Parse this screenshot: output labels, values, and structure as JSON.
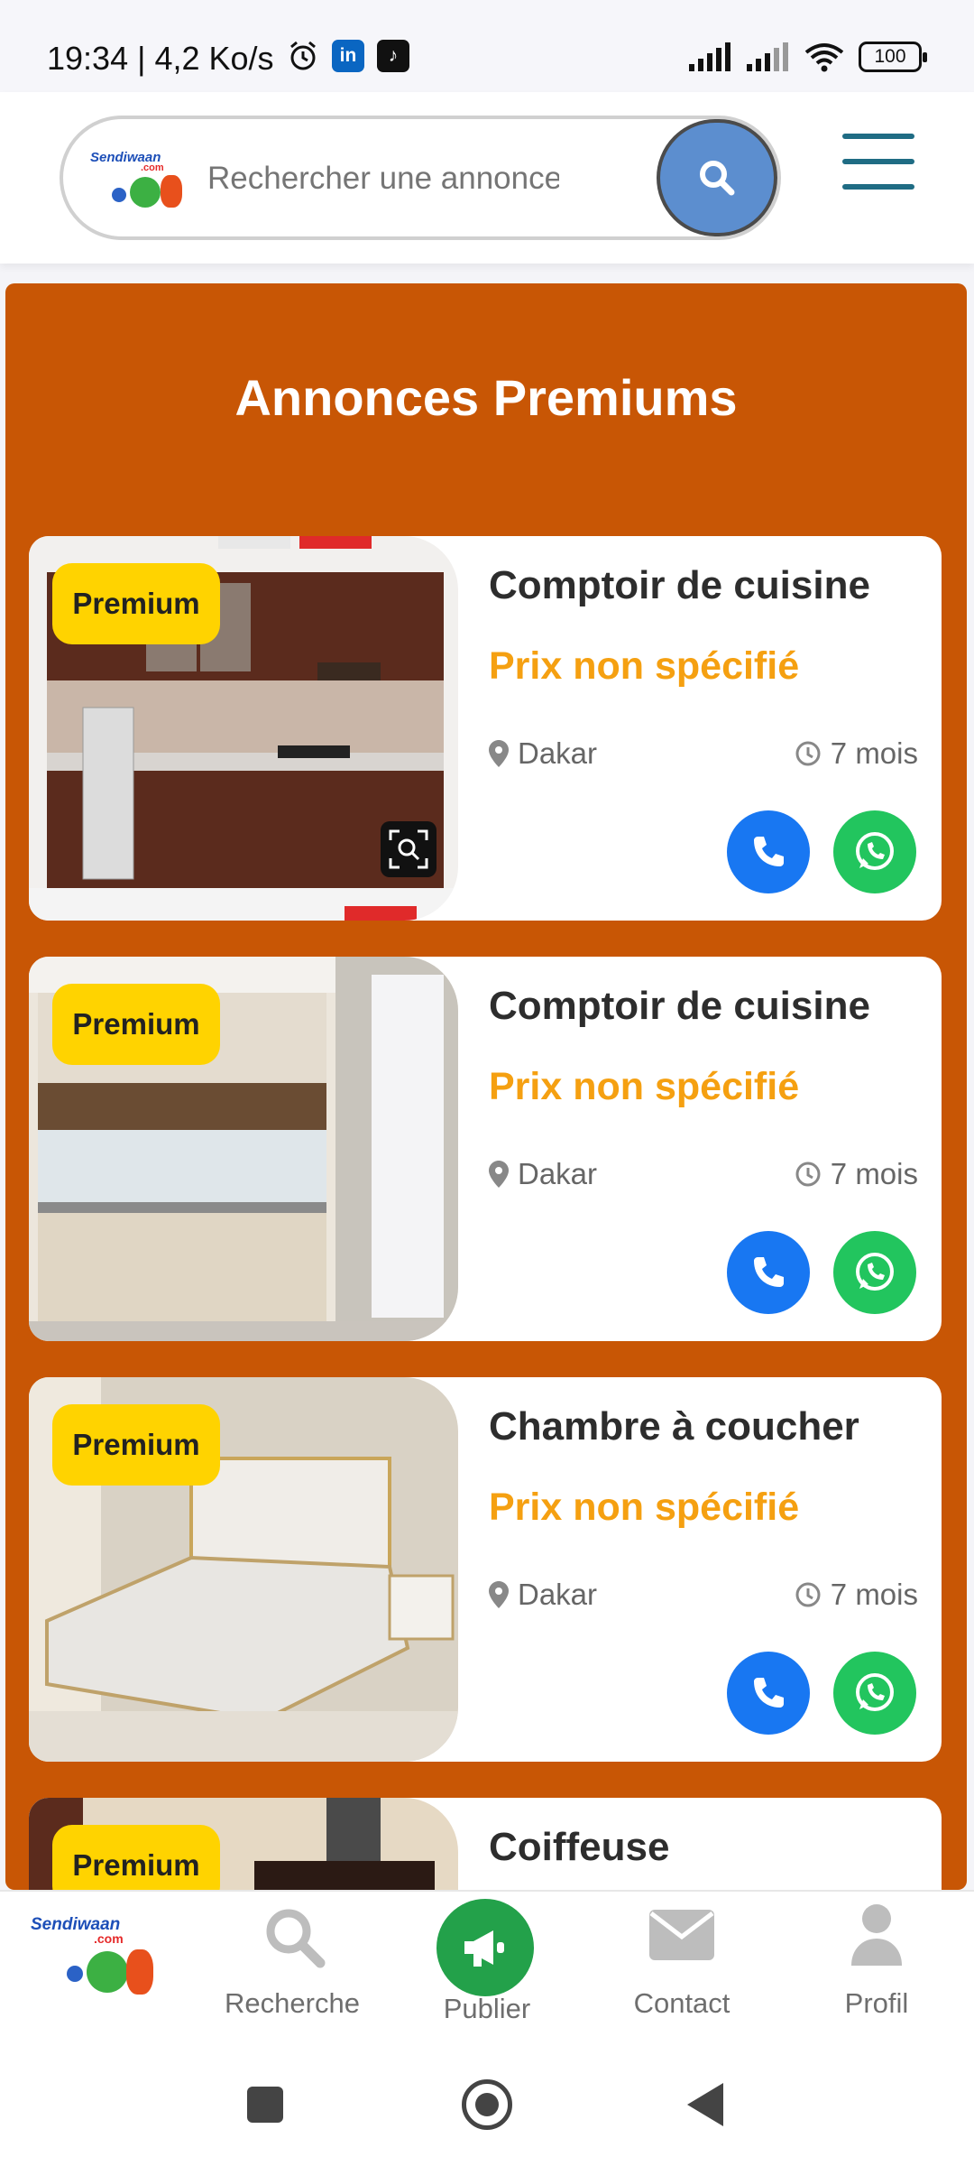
{
  "status_bar": {
    "time": "19:34 | 4,2 Ko/s",
    "battery": "100"
  },
  "header": {
    "logo_text": "Sendiwaan",
    "logo_subtext": ".com",
    "search": {
      "placeholder": "Rechercher une annonce",
      "value": ""
    }
  },
  "section": {
    "title": "Annonces Premiums"
  },
  "listings": [
    {
      "badge": "Premium",
      "title": "Comptoir de cuisine",
      "price": "Prix non spécifié",
      "location": "Dakar",
      "age": "7 mois"
    },
    {
      "badge": "Premium",
      "title": "Comptoir de cuisine",
      "price": "Prix non spécifié",
      "location": "Dakar",
      "age": "7 mois"
    },
    {
      "badge": "Premium",
      "title": "Chambre à coucher",
      "price": "Prix non spécifié",
      "location": "Dakar",
      "age": "7 mois"
    },
    {
      "badge": "Premium",
      "title": "Coiffeuse"
    }
  ],
  "bottom_nav": {
    "search": "Recherche",
    "publish": "Publier",
    "contact": "Contact",
    "profile": "Profil"
  },
  "colors": {
    "section_bg": "#c85605",
    "badge": "#ffd300",
    "price": "#f5a011",
    "phone": "#1877f2",
    "whatsapp": "#22c55e",
    "publish": "#23a14a",
    "search_button": "#5c8ecf"
  }
}
